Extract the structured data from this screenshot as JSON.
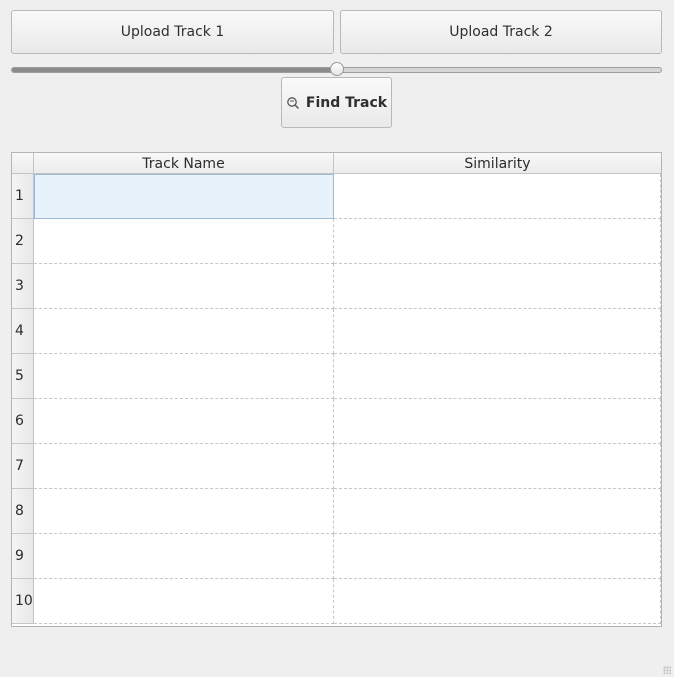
{
  "toolbar": {
    "upload_track_1": "Upload Track 1",
    "upload_track_2": "Upload Track 2",
    "find_track": "Find Track",
    "find_icon": "search-icon"
  },
  "slider": {
    "value_fraction": 0.5
  },
  "table": {
    "columns": [
      "Track Name",
      "Similarity"
    ],
    "rows": [
      {
        "index": "1",
        "track_name": "",
        "similarity": "",
        "selected": true
      },
      {
        "index": "2",
        "track_name": "",
        "similarity": ""
      },
      {
        "index": "3",
        "track_name": "",
        "similarity": ""
      },
      {
        "index": "4",
        "track_name": "",
        "similarity": ""
      },
      {
        "index": "5",
        "track_name": "",
        "similarity": ""
      },
      {
        "index": "6",
        "track_name": "",
        "similarity": ""
      },
      {
        "index": "7",
        "track_name": "",
        "similarity": ""
      },
      {
        "index": "8",
        "track_name": "",
        "similarity": ""
      },
      {
        "index": "9",
        "track_name": "",
        "similarity": ""
      },
      {
        "index": "10",
        "track_name": "",
        "similarity": ""
      }
    ]
  },
  "colors": {
    "background": "#efefef",
    "selection": "#e8f2fb"
  }
}
